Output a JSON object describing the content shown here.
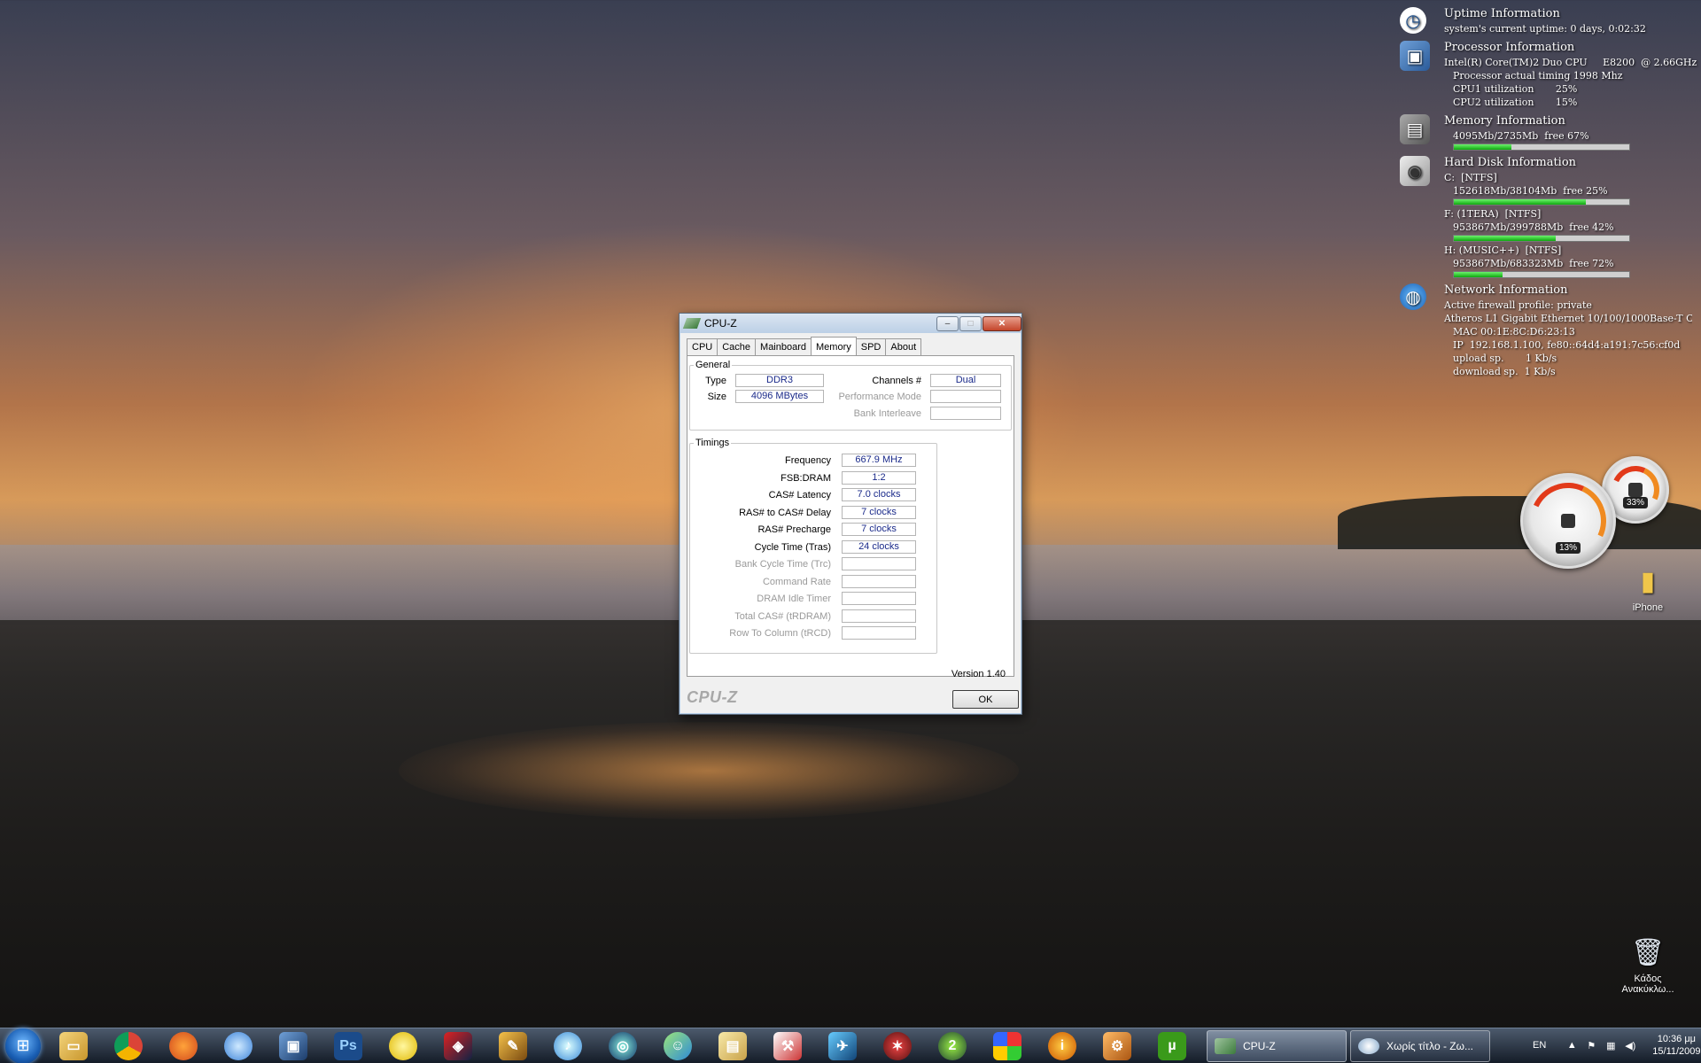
{
  "gadgets": {
    "uptime": {
      "title": "Uptime Information",
      "line1": "system's current uptime: 0 days, 0:02:32"
    },
    "processor": {
      "title": "Processor Information",
      "line1": "Intel(R) Core(TM)2 Duo CPU     E8200  @ 2.66GHz",
      "line2": "Processor actual timing 1998 Mhz",
      "line3": "CPU1 utilization       25%",
      "line4": "CPU2 utilization       15%"
    },
    "memory": {
      "title": "Memory Information",
      "line1": "4095Mb/2735Mb  free 67%",
      "bar_fraction": 0.33
    },
    "harddisk": {
      "title": "Hard Disk Information",
      "drives": [
        {
          "name": "C:  [NTFS]",
          "usage": "152618Mb/38104Mb  free 25%",
          "bar_fraction": 0.75
        },
        {
          "name": "F: (1TERA)  [NTFS]",
          "usage": "953867Mb/399788Mb  free 42%",
          "bar_fraction": 0.58
        },
        {
          "name": "H: (MUSIC++)  [NTFS]",
          "usage": "953867Mb/683323Mb  free 72%",
          "bar_fraction": 0.28
        }
      ]
    },
    "network": {
      "title": "Network Information",
      "line1": "Active firewall profile: private",
      "line2": "Atheros L1 Gigabit Ethernet 10/100/1000Base-T Co",
      "line3": "MAC 00:1E:8C:D6:23:13",
      "line4": "IP  192.168.1.100, fe80::64d4:a191:7c56:cf0d",
      "line5": "upload sp.       1 Kb/s",
      "line6": "download sp.  1 Kb/s"
    },
    "gauge_cpu": {
      "value": "13%",
      "level": 0.13
    },
    "gauge_mem": {
      "value": "33%",
      "level": 0.33
    }
  },
  "desktop": {
    "iphone_label": "iPhone",
    "recycle_label_1": "Κάδος",
    "recycle_label_2": "Ανακύκλω..."
  },
  "cpuz": {
    "title": "CPU-Z",
    "tabs": [
      "CPU",
      "Cache",
      "Mainboard",
      "Memory",
      "SPD",
      "About"
    ],
    "active_tab": "Memory",
    "general": {
      "legend": "General",
      "type_label": "Type",
      "type_value": "DDR3",
      "size_label": "Size",
      "size_value": "4096 MBytes",
      "channels_label": "Channels #",
      "channels_value": "Dual",
      "perf_label": "Performance Mode",
      "perf_value": "",
      "bank_label": "Bank Interleave",
      "bank_value": ""
    },
    "timings": {
      "legend": "Timings",
      "rows": [
        {
          "label": "Frequency",
          "value": "667.9 MHz",
          "enabled": true
        },
        {
          "label": "FSB:DRAM",
          "value": "1:2",
          "enabled": true
        },
        {
          "label": "CAS# Latency",
          "value": "7.0 clocks",
          "enabled": true
        },
        {
          "label": "RAS# to CAS# Delay",
          "value": "7 clocks",
          "enabled": true
        },
        {
          "label": "RAS# Precharge",
          "value": "7 clocks",
          "enabled": true
        },
        {
          "label": "Cycle Time (Tras)",
          "value": "24 clocks",
          "enabled": true
        },
        {
          "label": "Bank Cycle Time (Trc)",
          "value": "",
          "enabled": false
        },
        {
          "label": "Command Rate",
          "value": "",
          "enabled": false
        },
        {
          "label": "DRAM Idle Timer",
          "value": "",
          "enabled": false
        },
        {
          "label": "Total CAS# (tRDRAM)",
          "value": "",
          "enabled": false
        },
        {
          "label": "Row To Column (tRCD)",
          "value": "",
          "enabled": false
        }
      ]
    },
    "version": "Version 1.40",
    "brand": "CPU-Z",
    "ok_label": "OK"
  },
  "taskbar": {
    "tasks": [
      {
        "label": "CPU-Z"
      },
      {
        "label": "Χωρίς τίτλο - Ζω..."
      }
    ],
    "language": "EN",
    "time": "10:36 μμ",
    "date": "15/11/2009"
  },
  "colors": {
    "accent_value_text": "#1a2a8a",
    "progress_green": "#0fa80f",
    "close_red": "#c4452a"
  }
}
